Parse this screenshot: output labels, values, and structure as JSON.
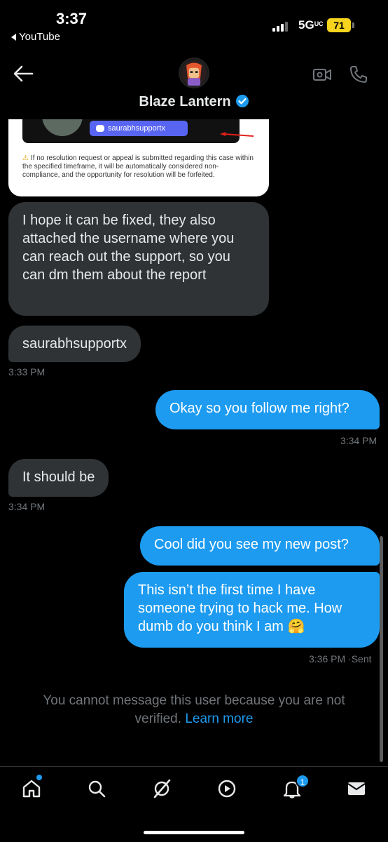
{
  "status_bar": {
    "time": "3:37",
    "back_app": "YouTube",
    "network": "5G",
    "network_suffix": "UC",
    "battery": "71"
  },
  "header": {
    "name": "Blaze Lantern",
    "verified": true
  },
  "shared_image": {
    "discord_username": "saurabhsupportx",
    "warning_text": "If no resolution request or appeal is submitted regarding this case within the specified timeframe, it will be automatically considered non-compliance, and the opportunity for resolution will be forfeited."
  },
  "messages": [
    {
      "side": "in",
      "text": "I hope it can be fixed, they also attached the username where you can reach out the support, so you can dm them about the report"
    },
    {
      "side": "in",
      "text": "saurabhsupportx",
      "time": "3:33 PM"
    },
    {
      "side": "out",
      "text": "Okay so you follow me right?",
      "time": "3:34 PM"
    },
    {
      "side": "in",
      "text": "It should be",
      "time": "3:34 PM"
    },
    {
      "side": "out",
      "text": "Cool did you see my new post?"
    },
    {
      "side": "out",
      "text": "This isn’t the first time I have someone trying to hack me. How dumb do you think I am 🤗",
      "time": "3:36 PM",
      "status": "Sent"
    }
  ],
  "footer_note": {
    "text": "You cannot message this user because you are not verified.",
    "link": "Learn more"
  },
  "tabbar": {
    "items": [
      "home-icon",
      "search-icon",
      "grok-icon",
      "video-icon",
      "notifications-icon",
      "messages-icon"
    ],
    "notification_count": "1"
  },
  "colors": {
    "accent": "#1d9bf0",
    "incoming_bubble": "#2f3336",
    "muted_text": "#71767b",
    "battery": "#f7d51e"
  }
}
